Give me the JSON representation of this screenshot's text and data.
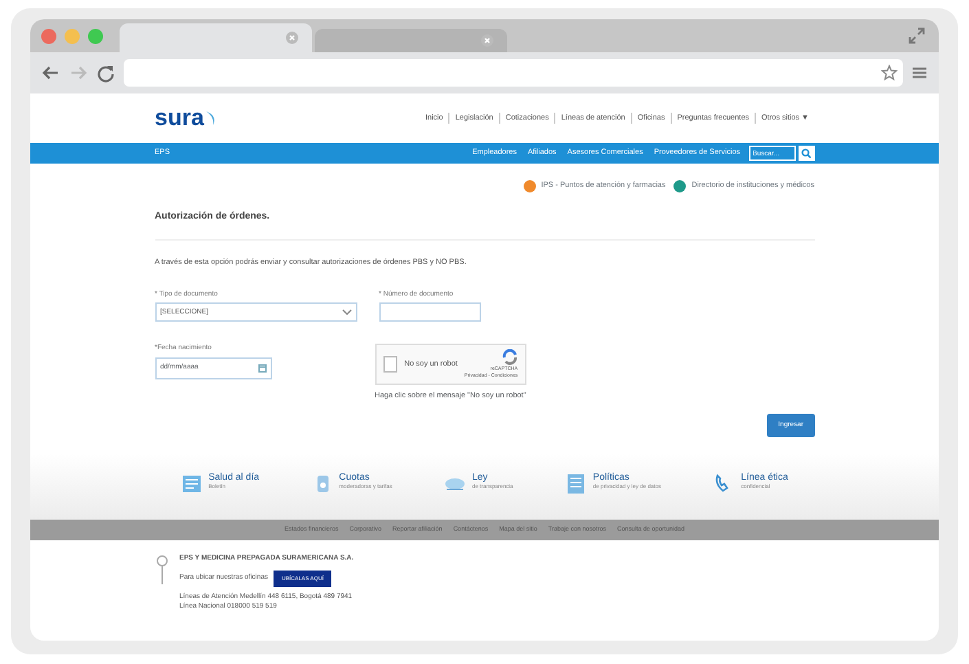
{
  "browser": {
    "tabs": [
      {
        "selected": true
      },
      {
        "selected": false
      }
    ],
    "nav": [
      {
        "kind": "back",
        "disabled": false
      },
      {
        "kind": "forward",
        "disabled": true
      },
      {
        "kind": "reload",
        "disabled": false
      }
    ]
  },
  "header": {
    "logo": "sura",
    "top_links": [
      "Inicio",
      "Legislación",
      "Cotizaciones",
      "Líneas de atención",
      "Oficinas",
      "Preguntas frecuentes",
      "Otros sitios ▼"
    ]
  },
  "navbar": {
    "brand": "EPS",
    "links": [
      "Empleadores",
      "Afiliados",
      "Asesores Comerciales",
      "Proveedores de Servicios"
    ],
    "search": {
      "placeholder": "Buscar..."
    }
  },
  "quick_links": [
    {
      "label": "IPS - Puntos de atención y farmacias",
      "color": "#f08a2c"
    },
    {
      "label": "Directorio de instituciones y médicos",
      "color": "#1e9a8a"
    }
  ],
  "form": {
    "title": "Autorización de órdenes.",
    "intro": "A través de esta opción podrás enviar y consultar autorizaciones de órdenes PBS y NO PBS.",
    "doc_type": {
      "label": "* Tipo de documento",
      "value": "[SELECCIONE]"
    },
    "doc_number": {
      "label": "* Número de documento"
    },
    "birth_date": {
      "label": "*Fecha nacimiento",
      "placeholder": "dd/mm/aaaa"
    },
    "captcha": {
      "label": "No soy un robot",
      "checked": false,
      "brand": "reCAPTCHA",
      "terms": "Privacidad - Condiciones"
    },
    "captcha_hint": "Haga clic sobre el mensaje \"No soy un robot\"",
    "submit": "Ingresar"
  },
  "features": [
    {
      "title": "Salud al día",
      "subtitle": "Boletín"
    },
    {
      "title": "Cuotas",
      "subtitle": "moderadoras y tarifas"
    },
    {
      "title": "Ley",
      "subtitle": "de transparencia"
    },
    {
      "title": "Políticas",
      "subtitle": "de privacidad y ley de datos"
    },
    {
      "title": "Línea ética",
      "subtitle": "confidencial"
    }
  ],
  "footer_links": [
    "Estados financieros",
    "Corporativo",
    "Reportar afiliación",
    "Contáctenos",
    "Mapa del sitio",
    "Trabaje con nosotros",
    "Consulta de oportunidad"
  ],
  "company": {
    "name": "EPS Y MEDICINA PREPAGADA SURAMERICANA S.A.",
    "offices_text": "Para ubicar nuestras oficinas",
    "offices_button": "UBÍCALAS AQUÍ",
    "phones": [
      "Líneas de Atención Medellín 448 6115, Bogotá 489 7941",
      "Línea Nacional 018000 519 519"
    ]
  }
}
